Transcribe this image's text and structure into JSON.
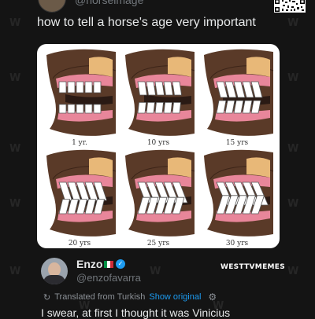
{
  "header": {
    "handle": "@horseimage",
    "text": "how to tell a horse's age very important"
  },
  "diagram": {
    "ages": [
      "1 yr.",
      "10 yrs",
      "15 yrs",
      "20 yrs",
      "25 yrs",
      "30 yrs"
    ]
  },
  "reply": {
    "name": "Enzo",
    "flag": "italy-flag-icon",
    "handle": "@enzofavarra",
    "brand": "WESTTVMEMES",
    "translated_label": "Translated from Turkish",
    "show_original": "Show original",
    "text": "I swear, at first I thought it was Vinicius"
  },
  "watermark": "W",
  "colors": {
    "background": "#141414",
    "link": "#1d9bf0",
    "muted": "#71767b"
  }
}
